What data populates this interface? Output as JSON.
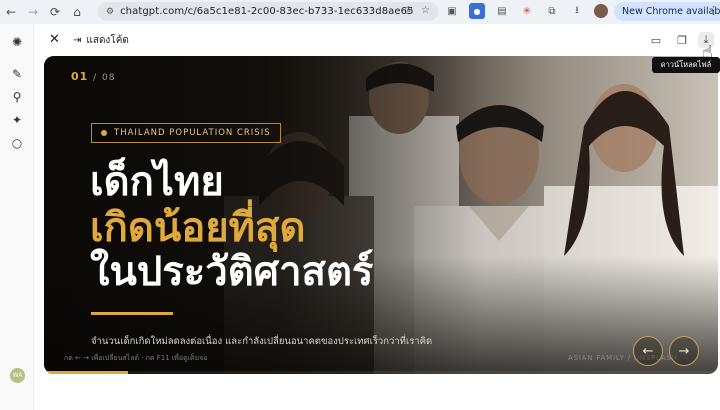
{
  "browser": {
    "url": "chatgpt.com/c/6a5c1e81-2c00-83ec-b733-1ec633d8ae65",
    "update_label": "New Chrome available"
  },
  "sidebar": {
    "avatar_initials": "WA"
  },
  "canvas_header": {
    "show_code_label": "แสดงโค้ด",
    "download_tooltip": "ดาวน์โหลดไฟล์"
  },
  "slide": {
    "current": "01",
    "separator": "/",
    "total": "08",
    "badge": "THAILAND POPULATION CRISIS",
    "headline_line1": "เด็กไทย",
    "headline_line2": "เกิดน้อยที่สุด",
    "headline_line3": "ในประวัติศาสตร์",
    "subtitle": "จำนวนเด็กเกิดใหม่ลดลงต่อเนื่อง และกำลังเปลี่ยนอนาคตของประเทศเร็วกว่าที่เราคิด",
    "hint": "กด ← → เพื่อเปลี่ยนสไลด์ · กด F11 เพื่อดูเต็มจอ",
    "photo_credit": "ASIAN FAMILY / UNSPLASH",
    "progress_fraction": 0.125,
    "accent_color": "#e0a93b"
  }
}
